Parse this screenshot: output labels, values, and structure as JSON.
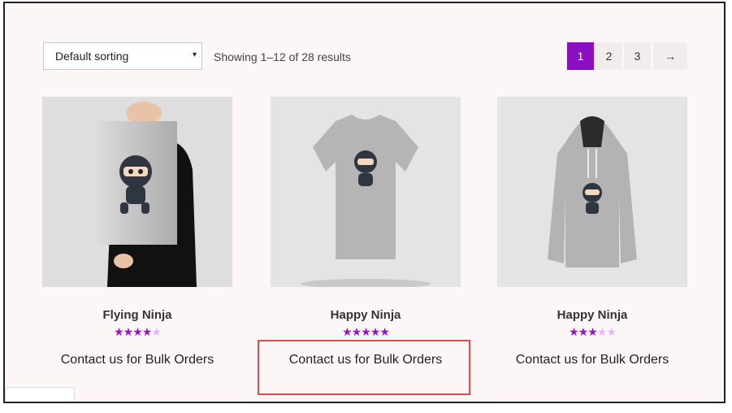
{
  "toolbar": {
    "sort_label": "Default sorting",
    "sort_arrow": "▾",
    "result_count": "Showing 1–12 of 28 results"
  },
  "pagination": {
    "pages": [
      "1",
      "2",
      "3"
    ],
    "next": "→",
    "current": "1"
  },
  "products": [
    {
      "name": "Flying Ninja",
      "rating": 4,
      "max_rating": 5,
      "action": "Contact us for Bulk Orders",
      "image": "poster-ninja"
    },
    {
      "name": "Happy Ninja",
      "rating": 5,
      "max_rating": 5,
      "action": "Contact us for Bulk Orders",
      "image": "tshirt-ninja"
    },
    {
      "name": "Happy Ninja",
      "rating": 3,
      "max_rating": 5,
      "action": "Contact us for Bulk Orders",
      "image": "hoodie-ninja"
    }
  ],
  "colors": {
    "accent": "#8b10c0",
    "star_full": "#9b12c6",
    "star_empty": "#e5b8f3",
    "highlight_box": "#e04b4b",
    "page_bg": "#fdf6f6"
  }
}
